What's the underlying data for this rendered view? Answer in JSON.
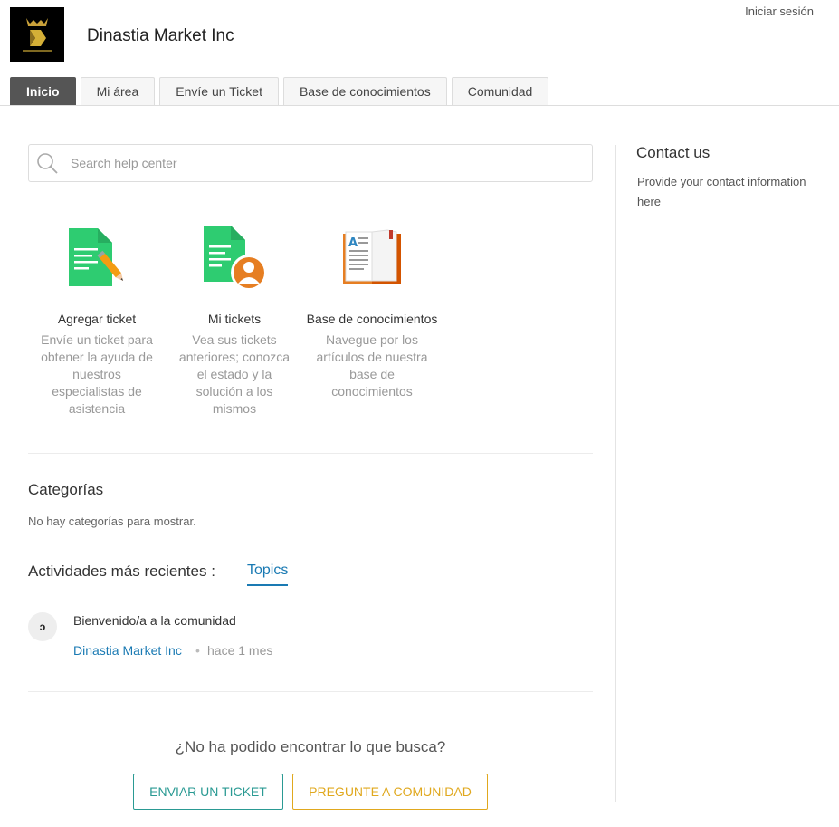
{
  "header": {
    "brand_name": "Dinastia Market Inc",
    "logo_text": "Dinastia Inc",
    "signin_label": "Iniciar sesión"
  },
  "tabs": [
    {
      "label": "Inicio",
      "active": true
    },
    {
      "label": "Mi área",
      "active": false
    },
    {
      "label": "Envíe un Ticket",
      "active": false
    },
    {
      "label": "Base de conocimientos",
      "active": false
    },
    {
      "label": "Comunidad",
      "active": false
    }
  ],
  "search": {
    "placeholder": "Search help center",
    "icon": "search-icon"
  },
  "cards": [
    {
      "title": "Agregar ticket",
      "description": "Envíe un ticket para obtener la ayuda de nuestros especialistas de asistencia",
      "icon": "add-ticket-icon"
    },
    {
      "title": "Mi tickets",
      "description": "Vea sus tickets anteriores; conozca el estado y la solución a los mismos",
      "icon": "my-tickets-icon"
    },
    {
      "title": "Base de conocimientos",
      "description": "Navegue por los artículos de nuestra base de conocimientos",
      "icon": "knowledge-base-icon"
    }
  ],
  "categories": {
    "title": "Categorías",
    "empty_text": "No hay categorías para mostrar."
  },
  "activity": {
    "title": "Actividades más recientes :",
    "tab_label": "Topics",
    "items": [
      {
        "avatar_text": "ɔ",
        "title": "Bienvenido/a a la comunidad",
        "author": "Dinastia Market Inc",
        "separator": "•",
        "time": "hace 1 mes"
      }
    ]
  },
  "footer": {
    "question": "¿No ha podido encontrar lo que busca?",
    "ticket_button": "ENVIAR UN TICKET",
    "community_button": "PREGUNTE A COMUNIDAD"
  },
  "contact": {
    "title": "Contact us",
    "text": "Provide your contact information here"
  },
  "colors": {
    "accent_blue": "#1a7ab3",
    "ticket_teal": "#2a9a93",
    "community_gold": "#e0a81e",
    "active_tab": "#555555",
    "icon_green": "#2ecc71",
    "icon_orange": "#e67e22"
  }
}
